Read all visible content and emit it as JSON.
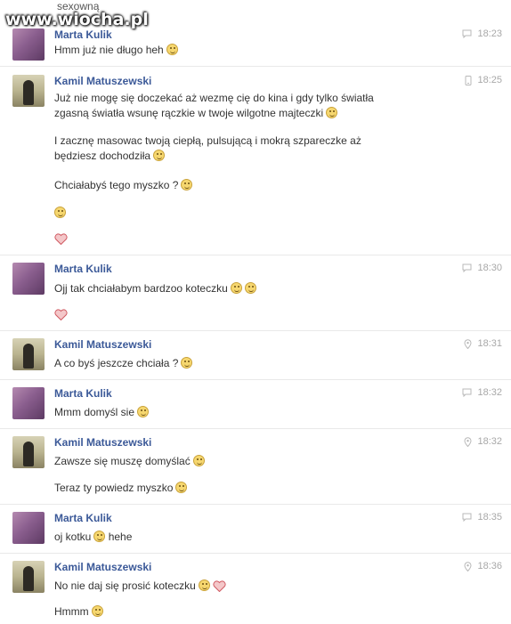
{
  "watermark": "www.wiocha.pl",
  "top_fragment": "sexowną",
  "messages": [
    {
      "sender": "Marta Kulik",
      "time": "18:23",
      "icon": "chat-bubble-icon",
      "lines": [
        "Hmm już nie długo heh"
      ]
    },
    {
      "sender": "Kamil Matuszewski",
      "time": "18:25",
      "icon": "mobile-phone-icon",
      "lines": [
        "Już nie mogę się doczekać aż wezmę cię do kina i gdy tylko światła",
        "zgasną światła wsunę rączkie w twoje wilgotne majteczki",
        "I zacznę masowac twoją ciepłą, pulsującą i mokrą szpareczke aż",
        "będziesz dochodziła",
        "Chciałabyś tego myszko ?"
      ]
    },
    {
      "sender": "Marta Kulik",
      "time": "18:30",
      "icon": "chat-bubble-icon",
      "lines": [
        "Ojj tak chciałabym bardzoo koteczku"
      ]
    },
    {
      "sender": "Kamil Matuszewski",
      "time": "18:31",
      "icon": "location-pin-icon",
      "lines": [
        "A co byś jeszcze chciała ?"
      ]
    },
    {
      "sender": "Marta Kulik",
      "time": "18:32",
      "icon": "chat-bubble-icon",
      "lines": [
        "Mmm domyśl sie"
      ]
    },
    {
      "sender": "Kamil Matuszewski",
      "time": "18:32",
      "icon": "location-pin-icon",
      "lines": [
        "Zawsze się muszę domyślać",
        "Teraz ty powiedz myszko"
      ]
    },
    {
      "sender": "Marta Kulik",
      "time": "18:35",
      "icon": "chat-bubble-icon",
      "lines": [
        "oj kotku",
        "hehe"
      ]
    },
    {
      "sender": "Kamil Matuszewski",
      "time": "18:36",
      "icon": "location-pin-icon",
      "lines": [
        "No nie daj się prosić koteczku",
        "Hmmm"
      ]
    }
  ]
}
